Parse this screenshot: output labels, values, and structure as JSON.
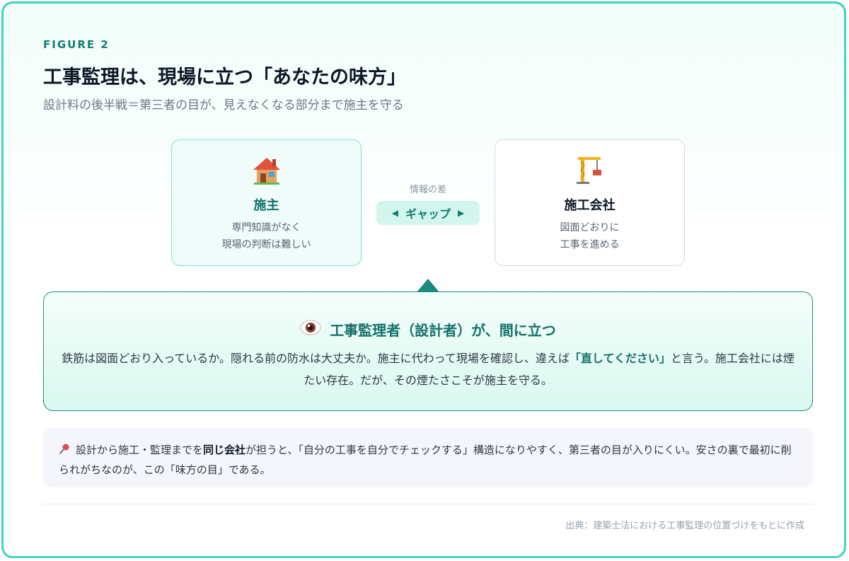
{
  "figure_label": "FIGURE 2",
  "title": "工事監理は、現場に立つ「あなたの味方」",
  "subtitle": "設計料の後半戦＝第三者の目が、見えなくなる部分まで施主を守る",
  "owner": {
    "icon": "house-icon",
    "name": "施主",
    "desc_line1": "専門知識がなく",
    "desc_line2": "現場の判断は難しい"
  },
  "gap": {
    "caption": "情報の差",
    "left_arrow": "◀",
    "label": "ギャップ",
    "right_arrow": "▶"
  },
  "builder": {
    "icon": "crane-icon",
    "name": "施工会社",
    "desc_line1": "図面どおりに",
    "desc_line2": "工事を進める"
  },
  "role": {
    "icon": "eye-icon",
    "title": "工事監理者（設計者）が、間に立つ",
    "body_part1": "鉄筋は図面どおり入っているか。隠れる前の防水は大丈夫か。施主に代わって現場を確認し、違えば",
    "body_emphasis": "「直してください」",
    "body_part2": "と言う。施工会社には煙たい存在。だが、その煙たさこそが施主を守る。"
  },
  "note": {
    "icon": "pushpin-icon",
    "part1": "設計から施工・監理までを",
    "bold": "同じ会社",
    "part2": "が担うと、「自分の工事を自分でチェックする」構造になりやすく、第三者の目が入りにくい。安さの裏で最初に削られがちなのが、この「味方の目」である。"
  },
  "source": "出典：建築士法における工事監理の位置づけをもとに作成",
  "colors": {
    "border": "#43d3c1",
    "accent": "#157b72",
    "pill_bg": "#d2f6ee",
    "panel_border": "#1b8a7f"
  }
}
